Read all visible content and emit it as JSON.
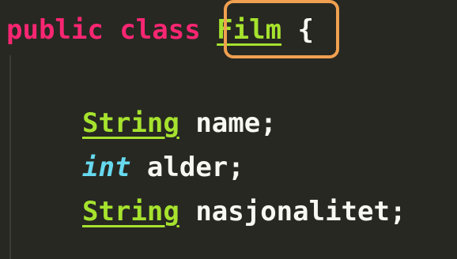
{
  "code": {
    "line1": {
      "public": "public",
      "class": "class",
      "class_name": "Film",
      "brace": "{"
    },
    "line2": {
      "type": "String",
      "name": "name",
      "semi": ";"
    },
    "line3": {
      "type": "int",
      "name": "alder",
      "semi": ";"
    },
    "line4": {
      "type": "String",
      "name": "nasjonalitet",
      "semi": ";"
    }
  },
  "colors": {
    "background": "#272822",
    "keyword": "#f92672",
    "type": "#a6e22e",
    "primitive": "#66d9ef",
    "text": "#f8f8f2",
    "highlight": "#f0a050"
  }
}
